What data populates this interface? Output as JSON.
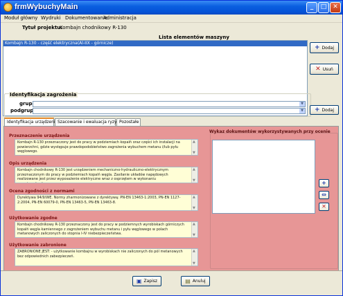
{
  "window": {
    "title": "frmWybuchyMain"
  },
  "menu": [
    "Moduł główny",
    "Wydruki",
    "Dokumentowanie",
    "Administracja"
  ],
  "project": {
    "label": "Tytuł projektu:",
    "value": "Kombajn chodnikowy R-130"
  },
  "list": {
    "header": "Lista elementów maszyny",
    "selected_item": "Kombajn R-130 - część elektryczna(Al-IIX - górnicze)"
  },
  "buttons": {
    "add": "Dodaj",
    "remove": "Usuń",
    "dodaj2": "Dodaj",
    "save": "Zapisz",
    "cancel": "Anuluj"
  },
  "identification": {
    "title": "Identyfikacja zagrożenia",
    "group_label": "grupa",
    "subgroup_label": "podgrupa",
    "group_value": "",
    "subgroup_value": ""
  },
  "tabs": [
    "Identyfikacja urządzenia",
    "Szacowanie i ewaluacja ryzyka",
    "Pozostałe"
  ],
  "sections": [
    {
      "title": "Przeznaczenie urządzenia",
      "text": "Kombajn R-130 przeznaczony jest do pracy w podziemiach kopalń oraz części ich instalacji na powierzchni, gdzie występuje prawdopodobieństwo zagrożenia wybuchem metanu i/lub pyłu węglowego."
    },
    {
      "title": "Opis urządzenia",
      "text": "Kombajn chodnikowy R-130 jest urządzeniem mechaniczno-hydrauliczno-elektrycznym przeznaczonym do pracy w podziemiach kopalń węgla. Zasilanie układów napędowych realizowane jest przez wyposażenie elektryczne wraz z osprzętem w wykonaniu przeciwwybuchowym."
    },
    {
      "title": "Ocena zgodności z normami",
      "text": "Dyrektywa 94/9/WE. Normy zharmonizowane z dyrektywą: PN-EN 13463-1:2003, PN-EN 1127-2:2004, PN-EN 60079-0, PN-EN 13463-5, PN-EN 13463-8."
    },
    {
      "title": "Użytkowanie zgodne",
      "text": "Kombajn chodnikowy R-130 przeznaczony jest do pracy w podziemnych wyrobiskach górniczych kopalń węgla kamiennego z zagrożeniem wybuchu metanu i pyłu węglowego w polach metanowych zaliczonych do stopnia I-IV niebezpieczeństwa."
    },
    {
      "title": "Użytkowanie zabronione",
      "text": "ZABRONIONE JEST: - użytkowanie kombajnu w wyrobiskach nie zaliczonych do pól metanowych bez odpowiednich zabezpieczeń."
    }
  ],
  "documents": {
    "title": "Wykaz dokumentów wykorzystywanych przy ocenie",
    "items": []
  }
}
